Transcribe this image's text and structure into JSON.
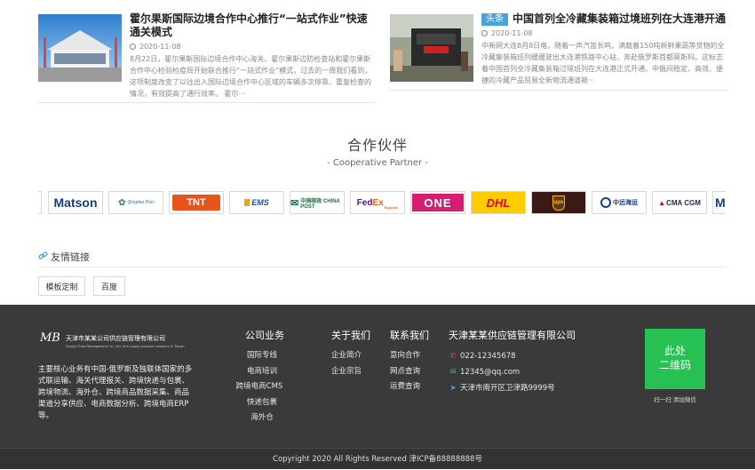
{
  "news": [
    {
      "tag": "",
      "title": "霍尔果斯国际边境合作中心推行“一站式作业”快速通关模式",
      "date": "2020-11-08",
      "summary": "8月22日，霍尔果斯国际边境合作中心海关、霍尔果斯边防检查站和霍尔果斯合作中心检验检疫局开始联合推行“一站式作业”模式，过去的一周我们看到，这项制度改变了以往出入国际边境合作中心区域的车辆多次停靠、重复检查的情况，有效提高了通行效率。 霍尔···"
    },
    {
      "tag": "头条",
      "title": "中国首列全冷藏集装箱过境班列在大连港开通",
      "date": "2020-11-08",
      "summary": "中新网大连8月8日电，随着一声汽笛长鸣，满载着150吨新鲜果蔬等货物的全冷藏集装箱班列缓缓驶出大连港铁路中心站，奔赴俄罗斯首都莫斯科。这标志着中国首列全冷藏集装箱过境班列在大连港正式开通，中俄间稳定、高效、便捷的冷藏产品贸易全新物流通道被···"
    }
  ],
  "partners": {
    "title": "合作伙伴",
    "subtitle": "- Cooperative Partner -",
    "logos": [
      "Matson",
      "Qingdao Port",
      "TNT",
      "EMS",
      "中国邮政 CHINA POST",
      "FedEx Express",
      "ONE",
      "DHL EXPRESS",
      "ups",
      "中远海运",
      "CMA CGM"
    ]
  },
  "links": {
    "title": "友情链接",
    "items": [
      "模板定制",
      "百度"
    ]
  },
  "footer": {
    "logo_mark": "MB",
    "company_cn": "天津市某某公司供应链管理有限公司",
    "company_en": "Supply Chain Management Co., Ltd. of a supply pressure company in Tianjin",
    "description": "主要核心业务有中国-俄罗斯及独联体国家的多式联运输、海关代理报关、跨境快递与包裹、跨境物流、海外仓、跨境商品数据采集、商品渠道分享供应、电商数据分析、跨境电商ERP等。",
    "columns": [
      {
        "heading": "公司业务",
        "items": [
          "国际专线",
          "电商培训",
          "跨境电商CMS",
          "快递包裹",
          "海外仓"
        ]
      },
      {
        "heading": "关于我们",
        "items": [
          "企业简介",
          "企业宗旨"
        ]
      },
      {
        "heading": "联系我们",
        "items": [
          "意向合作",
          "网点查询",
          "运费查询"
        ]
      }
    ],
    "contact": {
      "heading": "天津某某供应链管理有限公司",
      "phone": "022-12345678",
      "email": "12345@qq.com",
      "address": "天津市南开区卫津路9999号"
    },
    "qr_text_1": "此处",
    "qr_text_2": "二维码",
    "qr_caption": "扫一扫 添加微信",
    "copyright": "Copyright 2020 All Rights Reserved 津ICP备88888888号"
  },
  "colors": {
    "footer_bg": "#3a3a3a",
    "qr_green": "#27c053",
    "tag_blue": "#4aa3df",
    "link_icon_blue": "#4a90d9"
  }
}
